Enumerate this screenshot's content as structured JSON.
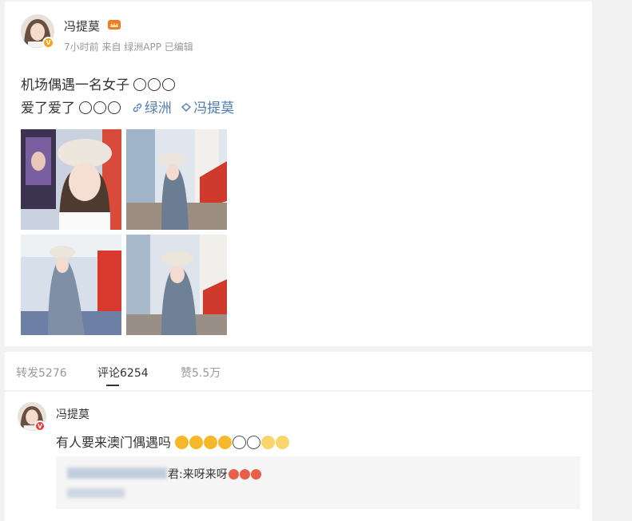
{
  "post": {
    "author": "冯提莫",
    "meta": "7小时前 来自 绿洲APP 已编辑",
    "line1": "机场偶遇一名女子",
    "line2": "爱了爱了",
    "link_app": "绿洲",
    "link_user": "冯提莫"
  },
  "tabs": {
    "repost": "转发5276",
    "comment": "评论6254",
    "like": "赞5.5万"
  },
  "comment": {
    "author": "冯提莫",
    "text": "有人要来澳门偶遇吗",
    "reply_suffix": "君:来呀来呀"
  },
  "colors": {
    "link": "#507daf",
    "verified_badge": "#f7a21b",
    "muted": "#999999"
  },
  "icons": {
    "crown": "crown-icon",
    "link": "link-icon",
    "tag": "tag-icon"
  }
}
